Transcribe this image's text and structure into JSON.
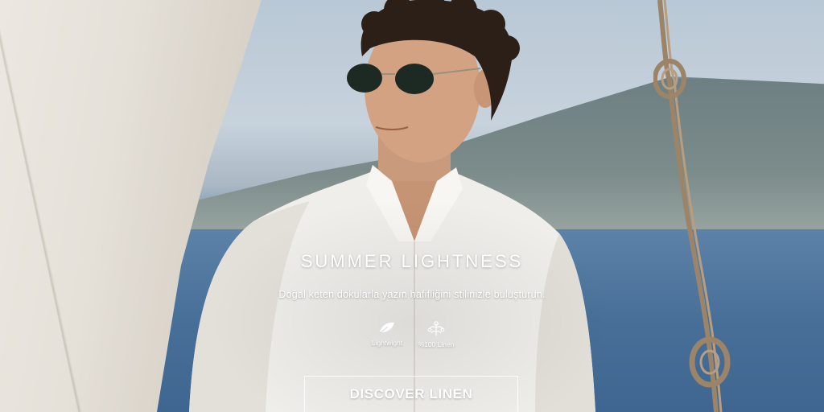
{
  "hero": {
    "headline": "SUMMER LIGHTNESS",
    "subtext": "Doğal keten dokularla yazın hafifliğini stilinizle buluşturun.",
    "features": [
      {
        "icon": "feather-icon",
        "label": "Lightwight"
      },
      {
        "icon": "linen-plant-icon",
        "label": "%100 Linen"
      }
    ],
    "cta_label": "DISCOVER LINEN"
  },
  "colors": {
    "text": "#ffffff",
    "sea": "#476f98",
    "sky": "#c7d2dc",
    "sail": "#e5e0d8"
  }
}
